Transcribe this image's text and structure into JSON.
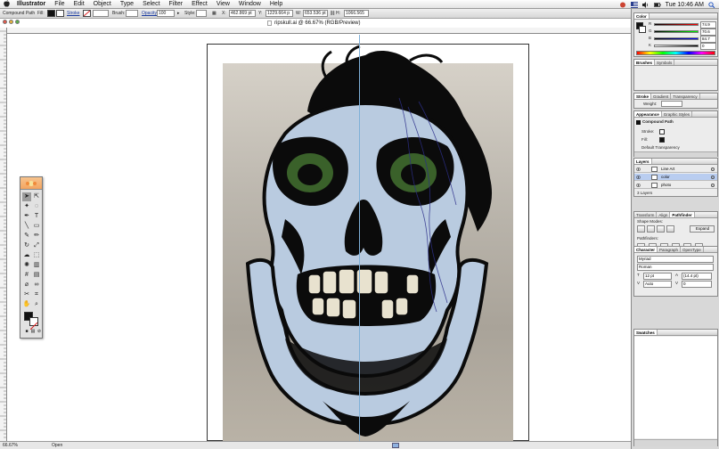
{
  "menubar": {
    "apple": "",
    "items": [
      "Illustrator",
      "File",
      "Edit",
      "Object",
      "Type",
      "Select",
      "Filter",
      "Effect",
      "View",
      "Window",
      "Help"
    ],
    "clock": "Tue 10:46 AM"
  },
  "controlbar": {
    "object_type": "Compound Path",
    "fill_label": "Fill:",
    "stroke_label": "Stroke",
    "brush_label": "Brush:",
    "opacity_label": "Opacity:",
    "opacity_value": "100",
    "style_label": "Style:",
    "x_label": "X:",
    "x_value": "462.869 pt",
    "y_label": "Y:",
    "y_value": "1229.664 p",
    "w_label": "W:",
    "w_value": "653.536 pt",
    "h_label": "H:",
    "h_value": "1066.565",
    "fill_color": "#111111",
    "stroke_color": "#ffffff"
  },
  "document": {
    "title": "ripskull.ai @ 66.67% (RGB/Preview)",
    "ruler_ticks": [
      "720",
      "684",
      "648",
      "612",
      "576",
      "540",
      "504",
      "468",
      "432",
      "396",
      "360",
      "324",
      "288",
      "252",
      "216",
      "180",
      "144",
      "108",
      "72",
      "36",
      "0",
      "36",
      "72",
      "108",
      "144",
      "180",
      "216",
      "252",
      "288",
      "324",
      "360",
      "396",
      "432",
      "468",
      "504",
      "540",
      "576",
      "612",
      "648",
      "684",
      "720",
      "756",
      "792",
      "828"
    ],
    "skull_color": "#b9cbe0",
    "ink_color": "#0b0b0b",
    "eye_color": "#3f6a2e",
    "scribble_color": "#2d2f8a",
    "guide_color": "#7fb0d8"
  },
  "statusbar": {
    "zoom": "66.67%",
    "status": "Open"
  },
  "toolbox": {
    "fill_color": "#111111",
    "stroke_color": "#ffffff"
  },
  "panels": {
    "color": {
      "tabs": [
        "Color"
      ],
      "r_label": "R",
      "r_value": "74.9",
      "g_label": "G",
      "g_value": "70.6",
      "b_label": "B",
      "b_value": "84.7",
      "k_label": "K",
      "k_value": "0"
    },
    "brushes": {
      "tabs": [
        "Brushes",
        "Symbols"
      ]
    },
    "stroke": {
      "tabs": [
        "Stroke",
        "Gradient",
        "Transparency"
      ],
      "weight_label": "Weight:"
    },
    "appearance": {
      "tabs": [
        "Appearance",
        "Graphic Styles"
      ],
      "title": "Compound Path",
      "stroke_label": "Stroke:",
      "fill_label": "Fill:",
      "default_label": "Default Transparency"
    },
    "layers": {
      "tabs": [
        "Layers"
      ],
      "rows": [
        "Line Art",
        "color",
        "photo"
      ],
      "footer": "3 Layers"
    },
    "pathfinder": {
      "tabs": [
        "Transform",
        "Align",
        "Pathfinder"
      ],
      "shape_modes_label": "Shape Modes:",
      "expand_label": "Expand",
      "pathfinders_label": "Pathfinders:"
    },
    "character": {
      "tabs": [
        "Character",
        "Paragraph",
        "OpenType"
      ],
      "font": "Myriad",
      "style": "Roman",
      "size": "12 pt",
      "leading": "(14.4 pt)",
      "tracking": "Auto",
      "kerning": "0"
    },
    "swatches": {
      "tabs": [
        "Swatches"
      ]
    }
  }
}
